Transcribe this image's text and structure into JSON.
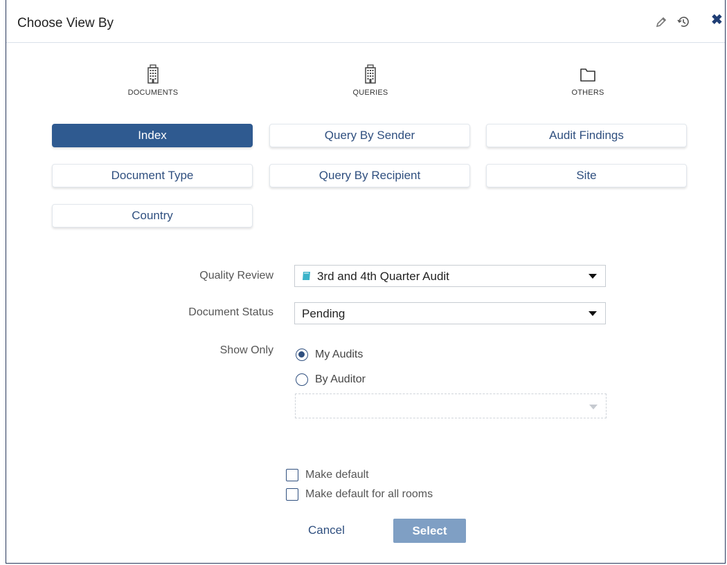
{
  "dialog": {
    "title": "Choose View By",
    "header_icons": [
      "pencil-icon",
      "history-icon",
      "close-icon"
    ],
    "close_glyph": "✖"
  },
  "categories": [
    {
      "label": "DOCUMENTS",
      "icon": "building-icon"
    },
    {
      "label": "QUERIES",
      "icon": "building-icon"
    },
    {
      "label": "OTHERS",
      "icon": "folder-icon"
    }
  ],
  "view_buttons": {
    "documents": [
      "Index",
      "Document Type",
      "Country"
    ],
    "queries": [
      "Query By Sender",
      "Query By Recipient"
    ],
    "others": [
      "Audit Findings",
      "Site"
    ],
    "active": "Index"
  },
  "form": {
    "quality_review": {
      "label": "Quality Review",
      "value": "3rd and 4th Quarter Audit",
      "icon": "book-icon"
    },
    "document_status": {
      "label": "Document Status",
      "value": "Pending"
    },
    "show_only": {
      "label": "Show Only",
      "options": [
        {
          "label": "My Audits",
          "selected": true
        },
        {
          "label": "By Auditor",
          "selected": false
        }
      ],
      "auditor_value": ""
    },
    "checkboxes": [
      {
        "label": "Make default",
        "checked": false
      },
      {
        "label": "Make default for all rooms",
        "checked": false
      }
    ]
  },
  "footer": {
    "cancel_label": "Cancel",
    "select_label": "Select"
  },
  "colors": {
    "accent": "#2f5a90",
    "link": "#2f4f7f",
    "select_button": "#7f9fc4",
    "border_dark": "#26365a"
  }
}
